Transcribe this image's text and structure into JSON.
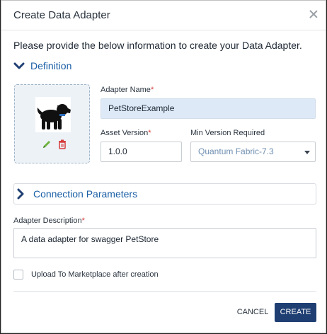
{
  "dialog": {
    "title": "Create Data Adapter",
    "intro": "Please provide the below information to create your Data Adapter."
  },
  "definition": {
    "section_label": "Definition",
    "adapter_name_label": "Adapter Name",
    "adapter_name_value": "PetStoreExample",
    "asset_version_label": "Asset Version",
    "asset_version_value": "1.0.0",
    "min_version_label": "Min Version Required",
    "min_version_value": "Quantum Fabric-7.3",
    "required_mark": "*"
  },
  "connection": {
    "section_label": "Connection Parameters"
  },
  "description": {
    "label": "Adapter Description",
    "value": "A data adapter for swagger PetStore"
  },
  "marketplace": {
    "label": "Upload To Marketplace after creation",
    "checked": false
  },
  "actions": {
    "cancel_label": "CANCEL",
    "create_label": "CREATE"
  },
  "icons": {
    "close": "close-icon",
    "definition_chevron": "chevron-down-icon",
    "connection_chevron": "chevron-right-icon",
    "logo": "dog-icon",
    "edit": "pencil-icon",
    "delete": "trash-icon",
    "select_caret": "caret-down-icon"
  },
  "colors": {
    "accent": "#1a5fa5",
    "primary_button": "#1f3f73",
    "required": "#d63b3b",
    "name_input_bg": "#dde9f7"
  }
}
